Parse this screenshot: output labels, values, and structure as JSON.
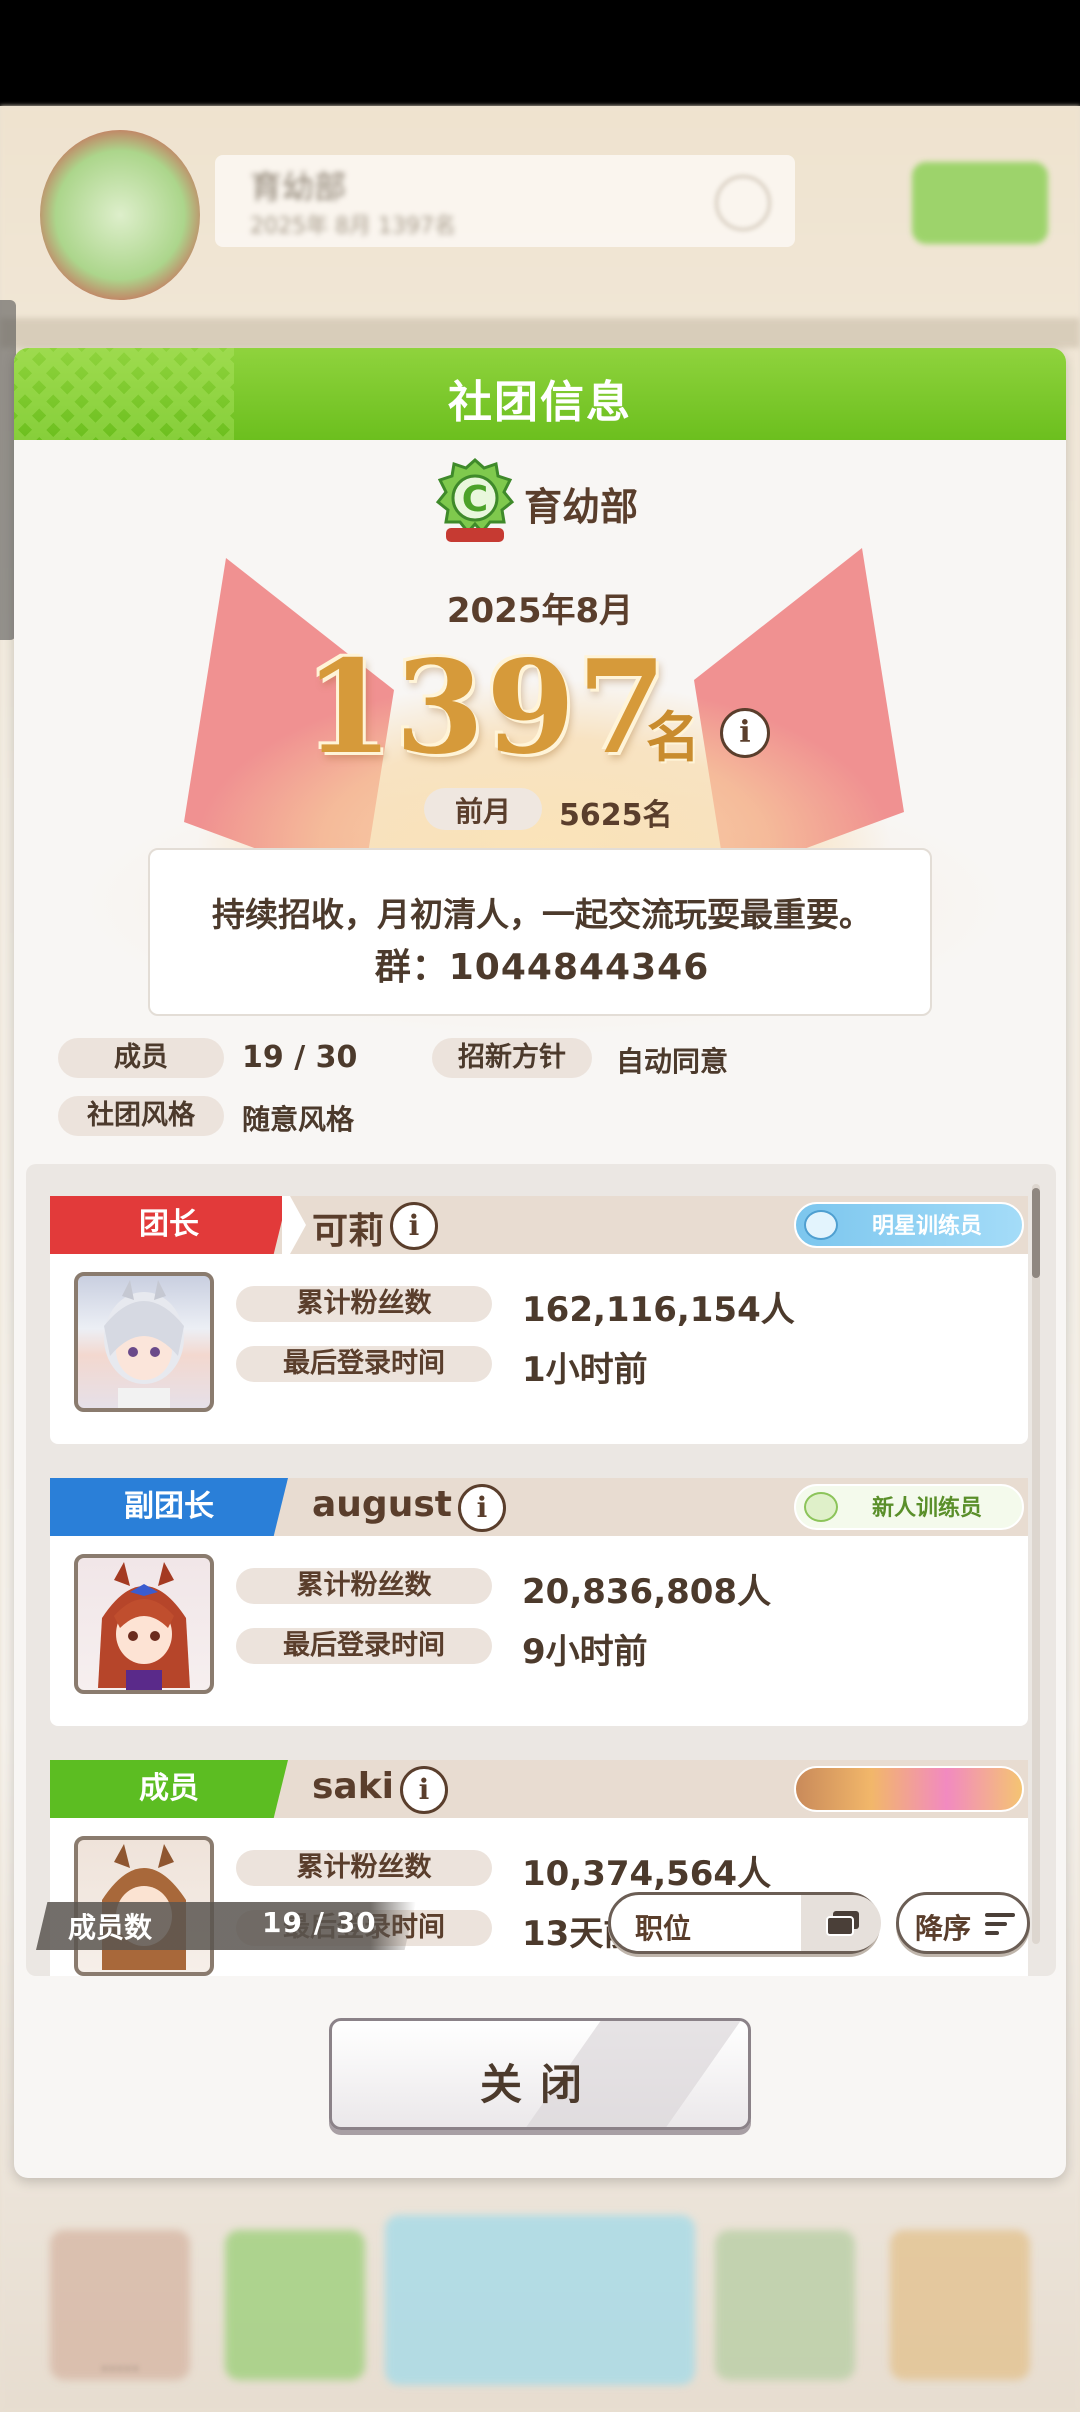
{
  "background": {
    "club_name": "育幼部",
    "club_sub": "2025年 8月 1397名"
  },
  "dialog": {
    "title": "社团信息",
    "club_name": "育幼部",
    "rank_month": "2025年8月",
    "rank_number": "1397",
    "rank_unit": "名",
    "info_glyph": "i",
    "prev_label": "前月",
    "prev_value": "5625名",
    "description_line1": "持续招收，月初清人，一起交流玩耍最重要。",
    "description_line2": "群：1044844346",
    "members_label": "成员",
    "members_value": "19 / 30",
    "recruit_label": "招新方针",
    "recruit_value": "自动同意",
    "style_label": "社团风格",
    "style_value": "随意风格"
  },
  "members": [
    {
      "role": "团长",
      "role_color": "#e23a3a",
      "name": "可莉",
      "badge": "明星训练员",
      "badge_bg": "#8fd0f4",
      "badge_fg": "#ffffff",
      "fans_label": "累计粉丝数",
      "fans_value": "162,116,154人",
      "login_label": "最后登录时间",
      "login_value": "1小时前",
      "avatar_icon": "gray-hair-girl-avatar"
    },
    {
      "role": "副团长",
      "role_color": "#2a7fd8",
      "name": "august",
      "badge": "新人训练员",
      "badge_bg": "#f1f8e9",
      "badge_fg": "#5a8f2a",
      "fans_label": "累计粉丝数",
      "fans_value": "20,836,808人",
      "login_label": "最后登录时间",
      "login_value": "9小时前",
      "avatar_icon": "red-hair-girl-avatar"
    },
    {
      "role": "成员",
      "role_color": "#5cbd22",
      "name": "saki",
      "badge": "",
      "badge_bg": "#f4b060",
      "badge_fg": "#ffffff",
      "fans_label": "累计粉丝数",
      "fans_value": "10,374,564人",
      "login_label": "最后登录时间",
      "login_value": "13天前",
      "avatar_icon": "brown-hair-girl-avatar"
    }
  ],
  "list_controls": {
    "count_label": "成员数",
    "count_value": "19 / 30",
    "sort_label": "职位",
    "order_label": "降序"
  },
  "close_label": "关闭"
}
